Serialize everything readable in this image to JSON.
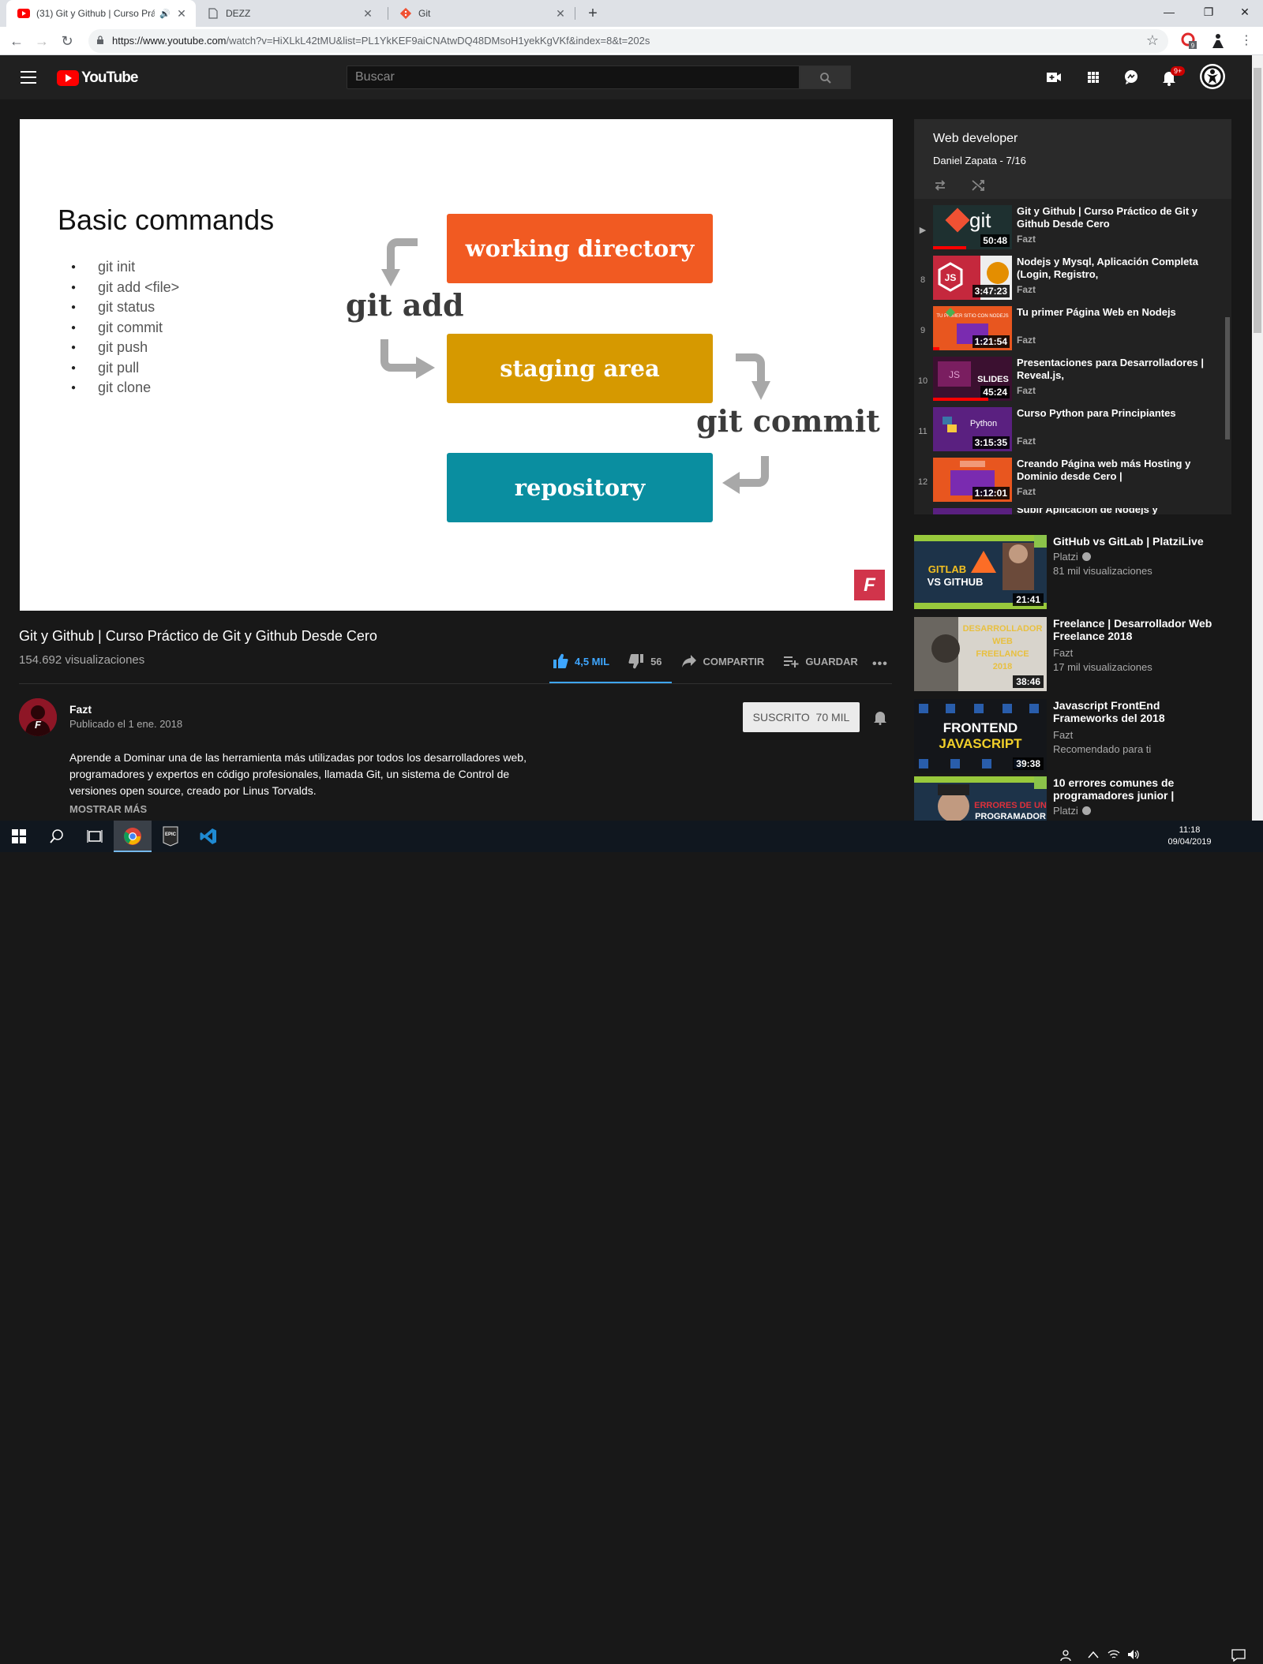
{
  "browser": {
    "tabs": [
      {
        "title": "(31) Git y Github | Curso Práctico de Git y Github Desde Cero - YouTube",
        "display": "(31) Git y Github | Curso Prác",
        "active": true,
        "icon": "youtube-icon"
      },
      {
        "title": "DEZZ",
        "display": "DEZZ",
        "active": false,
        "icon": "page-icon"
      },
      {
        "title": "Git",
        "display": "Git",
        "active": false,
        "icon": "git-icon"
      }
    ],
    "url_host": "https://www.youtube.com",
    "url_path": "/watch?v=HiXLkL42tMU&list=PL1YkKEF9aiCNAtwDQ48DMsoH1yekKgVKf&index=8&t=202s",
    "extension_badge": "9"
  },
  "masthead": {
    "logo_text": "YouTube",
    "search_placeholder": "Buscar",
    "notification_count": "9+"
  },
  "slide": {
    "title": "Basic commands",
    "commands": [
      "git init",
      "git add <file>",
      "git status",
      "git commit",
      "git push",
      "git pull",
      "git clone"
    ],
    "boxes": {
      "working": "working directory",
      "staging": "staging area",
      "repo": "repository"
    },
    "label_add": "git add",
    "label_commit": "git commit",
    "logo": "F"
  },
  "video": {
    "title": "Git y Github | Curso Práctico de Git y Github Desde Cero",
    "views": "154.692 visualizaciones",
    "likes": "4,5 MIL",
    "dislikes": "56",
    "share": "COMPARTIR",
    "save": "GUARDAR",
    "channel": "Fazt",
    "published": "Publicado el 1 ene. 2018",
    "subscribe_label": "SUSCRITO",
    "subscribers": "70 MIL",
    "description": "Aprende a Dominar una de las herramienta más utilizadas por todos los desarrolladores web, programadores y expertos en código profesionales, llamada Git, un sistema de Control de versiones open source, creado por Linus Torvalds.",
    "show_more": "MOSTRAR MÁS"
  },
  "playlist": {
    "title": "Web developer",
    "subtitle": "Daniel Zapata - 7/16",
    "items": [
      {
        "index": "▶",
        "title": "Git y Github | Curso Práctico de Git y Github Desde Cero",
        "channel": "Fazt",
        "duration": "50:48",
        "thumb_text": "git"
      },
      {
        "index": "8",
        "title": "Nodejs y Mysql, Aplicación Completa (Login, Registro,",
        "channel": "Fazt",
        "duration": "3:47:23",
        "thumb_text": "JS"
      },
      {
        "index": "9",
        "title": "Tu primer Página Web en Nodejs",
        "channel": "Fazt",
        "duration": "1:21:54",
        "thumb_text": "TU PRIMER SITIO CON NODEJS"
      },
      {
        "index": "10",
        "title": "Presentaciones para Desarrolladores | Reveal.js,",
        "channel": "Fazt",
        "duration": "45:24",
        "thumb_text": "SLIDES"
      },
      {
        "index": "11",
        "title": "Curso Python para Principiantes",
        "channel": "Fazt",
        "duration": "3:15:35",
        "thumb_text": "Python"
      },
      {
        "index": "12",
        "title": "Creando Página web más Hosting y Dominio desde Cero |",
        "channel": "Fazt",
        "duration": "1:12:01",
        "thumb_text": ""
      },
      {
        "index": "",
        "title": "Subir Aplicación de Nodejs y",
        "channel": "",
        "duration": "",
        "thumb_text": ""
      }
    ]
  },
  "recommendations": [
    {
      "title": "GitHub vs GitLab | PlatziLive",
      "channel": "Platzi",
      "verified": true,
      "meta": "81 mil visualizaciones",
      "duration": "21:41",
      "thumb_text": "GITLAB VS GITHUB"
    },
    {
      "title": "Freelance | Desarrollador Web Freelance 2018",
      "channel": "Fazt",
      "verified": false,
      "meta": "17 mil visualizaciones",
      "duration": "38:46",
      "thumb_text": "DESARROLLADOR WEB FREELANCE 2018"
    },
    {
      "title": "Javascript FrontEnd Frameworks del 2018",
      "channel": "Fazt",
      "verified": false,
      "meta": "Recomendado para ti",
      "duration": "39:38",
      "thumb_text": "FRONTEND JAVASCRIPT"
    },
    {
      "title": "10 errores comunes de programadores junior |",
      "channel": "Platzi",
      "verified": true,
      "meta": "",
      "duration": "",
      "thumb_text": "ERRORES DE UN PROGRAMADOR"
    }
  ],
  "taskbar": {
    "time": "11:18",
    "date": "09/04/2019",
    "epic_label": "EPIC"
  },
  "colors": {
    "yt_red": "#ff0000",
    "like_blue": "#3ea6ff",
    "box_orange": "#f15a22",
    "box_yellow": "#d69900",
    "box_teal": "#0a8ea0",
    "fazt_red": "#d1344b"
  }
}
